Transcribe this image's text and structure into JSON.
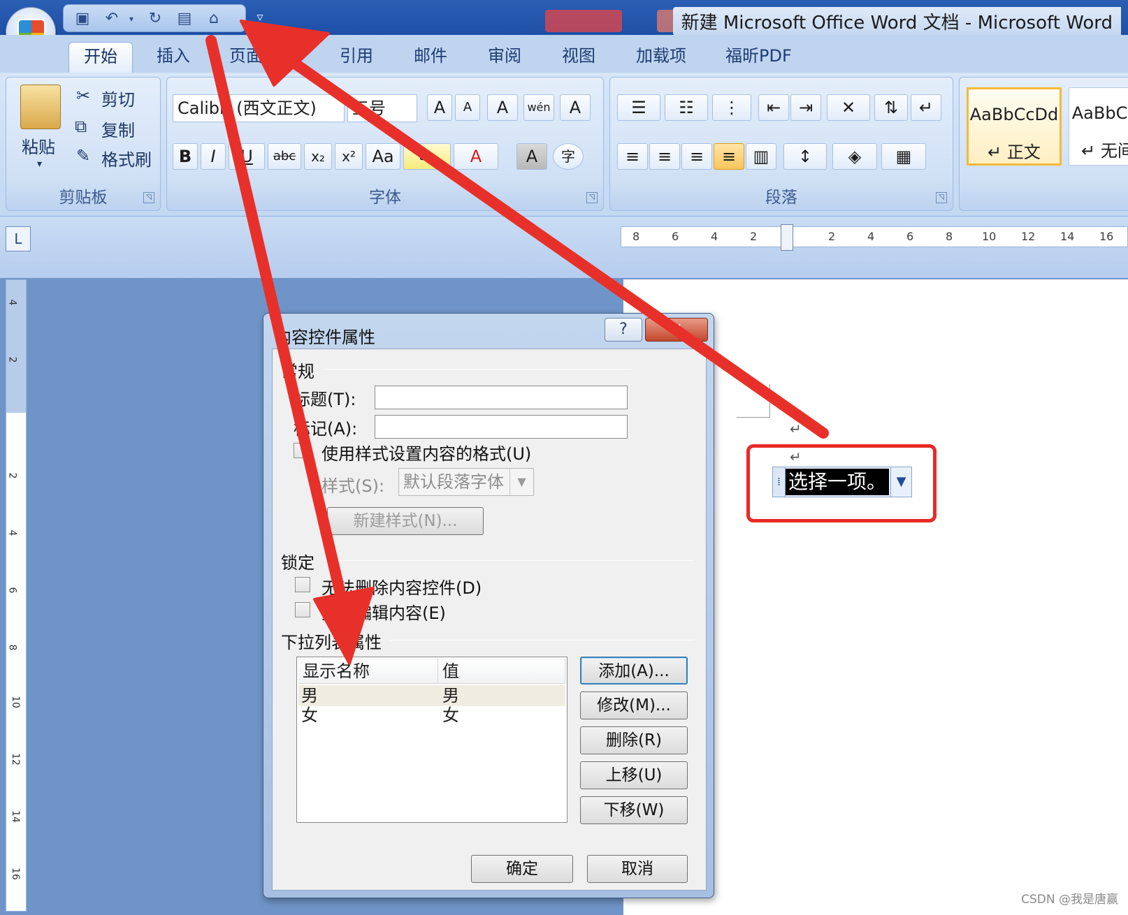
{
  "title_bar": {
    "title": "新建 Microsoft Office Word 文档 - Microsoft Word"
  },
  "quick_access": {
    "icons": [
      "save-icon",
      "undo-icon",
      "redo-icon",
      "table-icon",
      "properties-icon",
      "customize-icon"
    ],
    "more": "▿"
  },
  "tabs": [
    "开始",
    "插入",
    "页面布局",
    "引用",
    "邮件",
    "审阅",
    "视图",
    "加载项",
    "福昕PDF"
  ],
  "ribbon": {
    "clipboard": {
      "paste": "粘贴",
      "cut": "剪切",
      "copy": "复制",
      "format_painter": "格式刷",
      "label": "剪贴板"
    },
    "font": {
      "font_name": "Calibri (西文正文)",
      "font_size": "五号",
      "grow": "A",
      "shrink": "A",
      "clear": "A",
      "phonetic": "wén",
      "border": "A",
      "bold": "B",
      "italic": "I",
      "underline": "U",
      "strike": "abc",
      "subscript": "x₂",
      "superscript": "x²",
      "case": "Aa",
      "highlight": "ab",
      "color": "A",
      "shade": "A",
      "enclose": "字",
      "label": "字体"
    },
    "paragraph": {
      "label": "段落"
    },
    "styles": [
      {
        "sample": "AaBbCcDd",
        "name": "↵ 正文"
      },
      {
        "sample": "AaBbCcDd",
        "name": "↵ 无间隔"
      }
    ]
  },
  "ruler": {
    "h_ticks": [
      "8",
      "6",
      "4",
      "2",
      "2",
      "4",
      "6",
      "8",
      "10",
      "12",
      "14",
      "16"
    ],
    "v_ticks": [
      "4",
      "2",
      "2",
      "4",
      "6",
      "8",
      "10",
      "12",
      "14",
      "16"
    ],
    "corner": "L"
  },
  "document": {
    "pilcrow": "↵",
    "content_control_text": "选择一项。",
    "watermark": "CSDN @我是唐赢"
  },
  "dialog": {
    "title": "内容控件属性",
    "help": "?",
    "close": "X",
    "general_section": "常规",
    "title_label": "标题(T):",
    "title_value": "",
    "tag_label": "标记(A):",
    "tag_value": "",
    "use_style": "使用样式设置内容的格式(U)",
    "style_label": "样式(S):",
    "style_value": "默认段落字体",
    "new_style": "新建样式(N)...",
    "lock_section": "锁定",
    "lock_delete": "无法删除内容控件(D)",
    "lock_edit": "无法编辑内容(E)",
    "dropdown_section": "下拉列表属性",
    "columns": [
      "显示名称",
      "值"
    ],
    "items": [
      {
        "display": "男",
        "value": "男"
      },
      {
        "display": "女",
        "value": "女"
      }
    ],
    "buttons": {
      "add": "添加(A)...",
      "modify": "修改(M)...",
      "remove": "删除(R)",
      "move_up": "上移(U)",
      "move_down": "下移(W)",
      "ok": "确定",
      "cancel": "取消"
    }
  },
  "colors": {
    "arrow": "#e8302a",
    "ribbon": "#c3d8f2",
    "titlebar": "#1d4fa6"
  }
}
